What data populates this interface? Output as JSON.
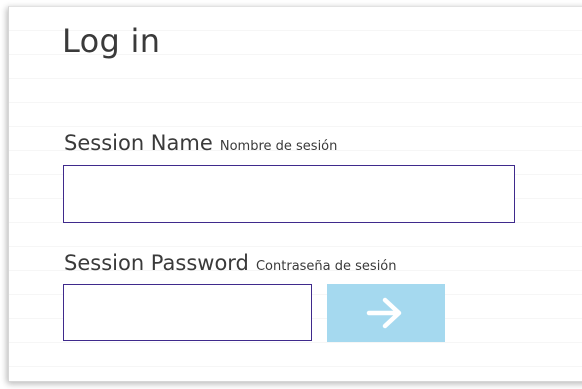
{
  "login": {
    "title": "Log in",
    "session_name": {
      "label": "Session Name",
      "sublabel": "Nombre de sesión",
      "value": "",
      "placeholder": ""
    },
    "session_password": {
      "label": "Session Password",
      "sublabel": "Contraseña de sesión",
      "value": "",
      "placeholder": ""
    },
    "submit": {
      "icon": "arrow-right-icon"
    }
  },
  "colors": {
    "field_border": "#3f2a8c",
    "submit_bg": "#a5d9ef",
    "submit_icon": "#ffffff",
    "text": "#3a3a3a"
  }
}
